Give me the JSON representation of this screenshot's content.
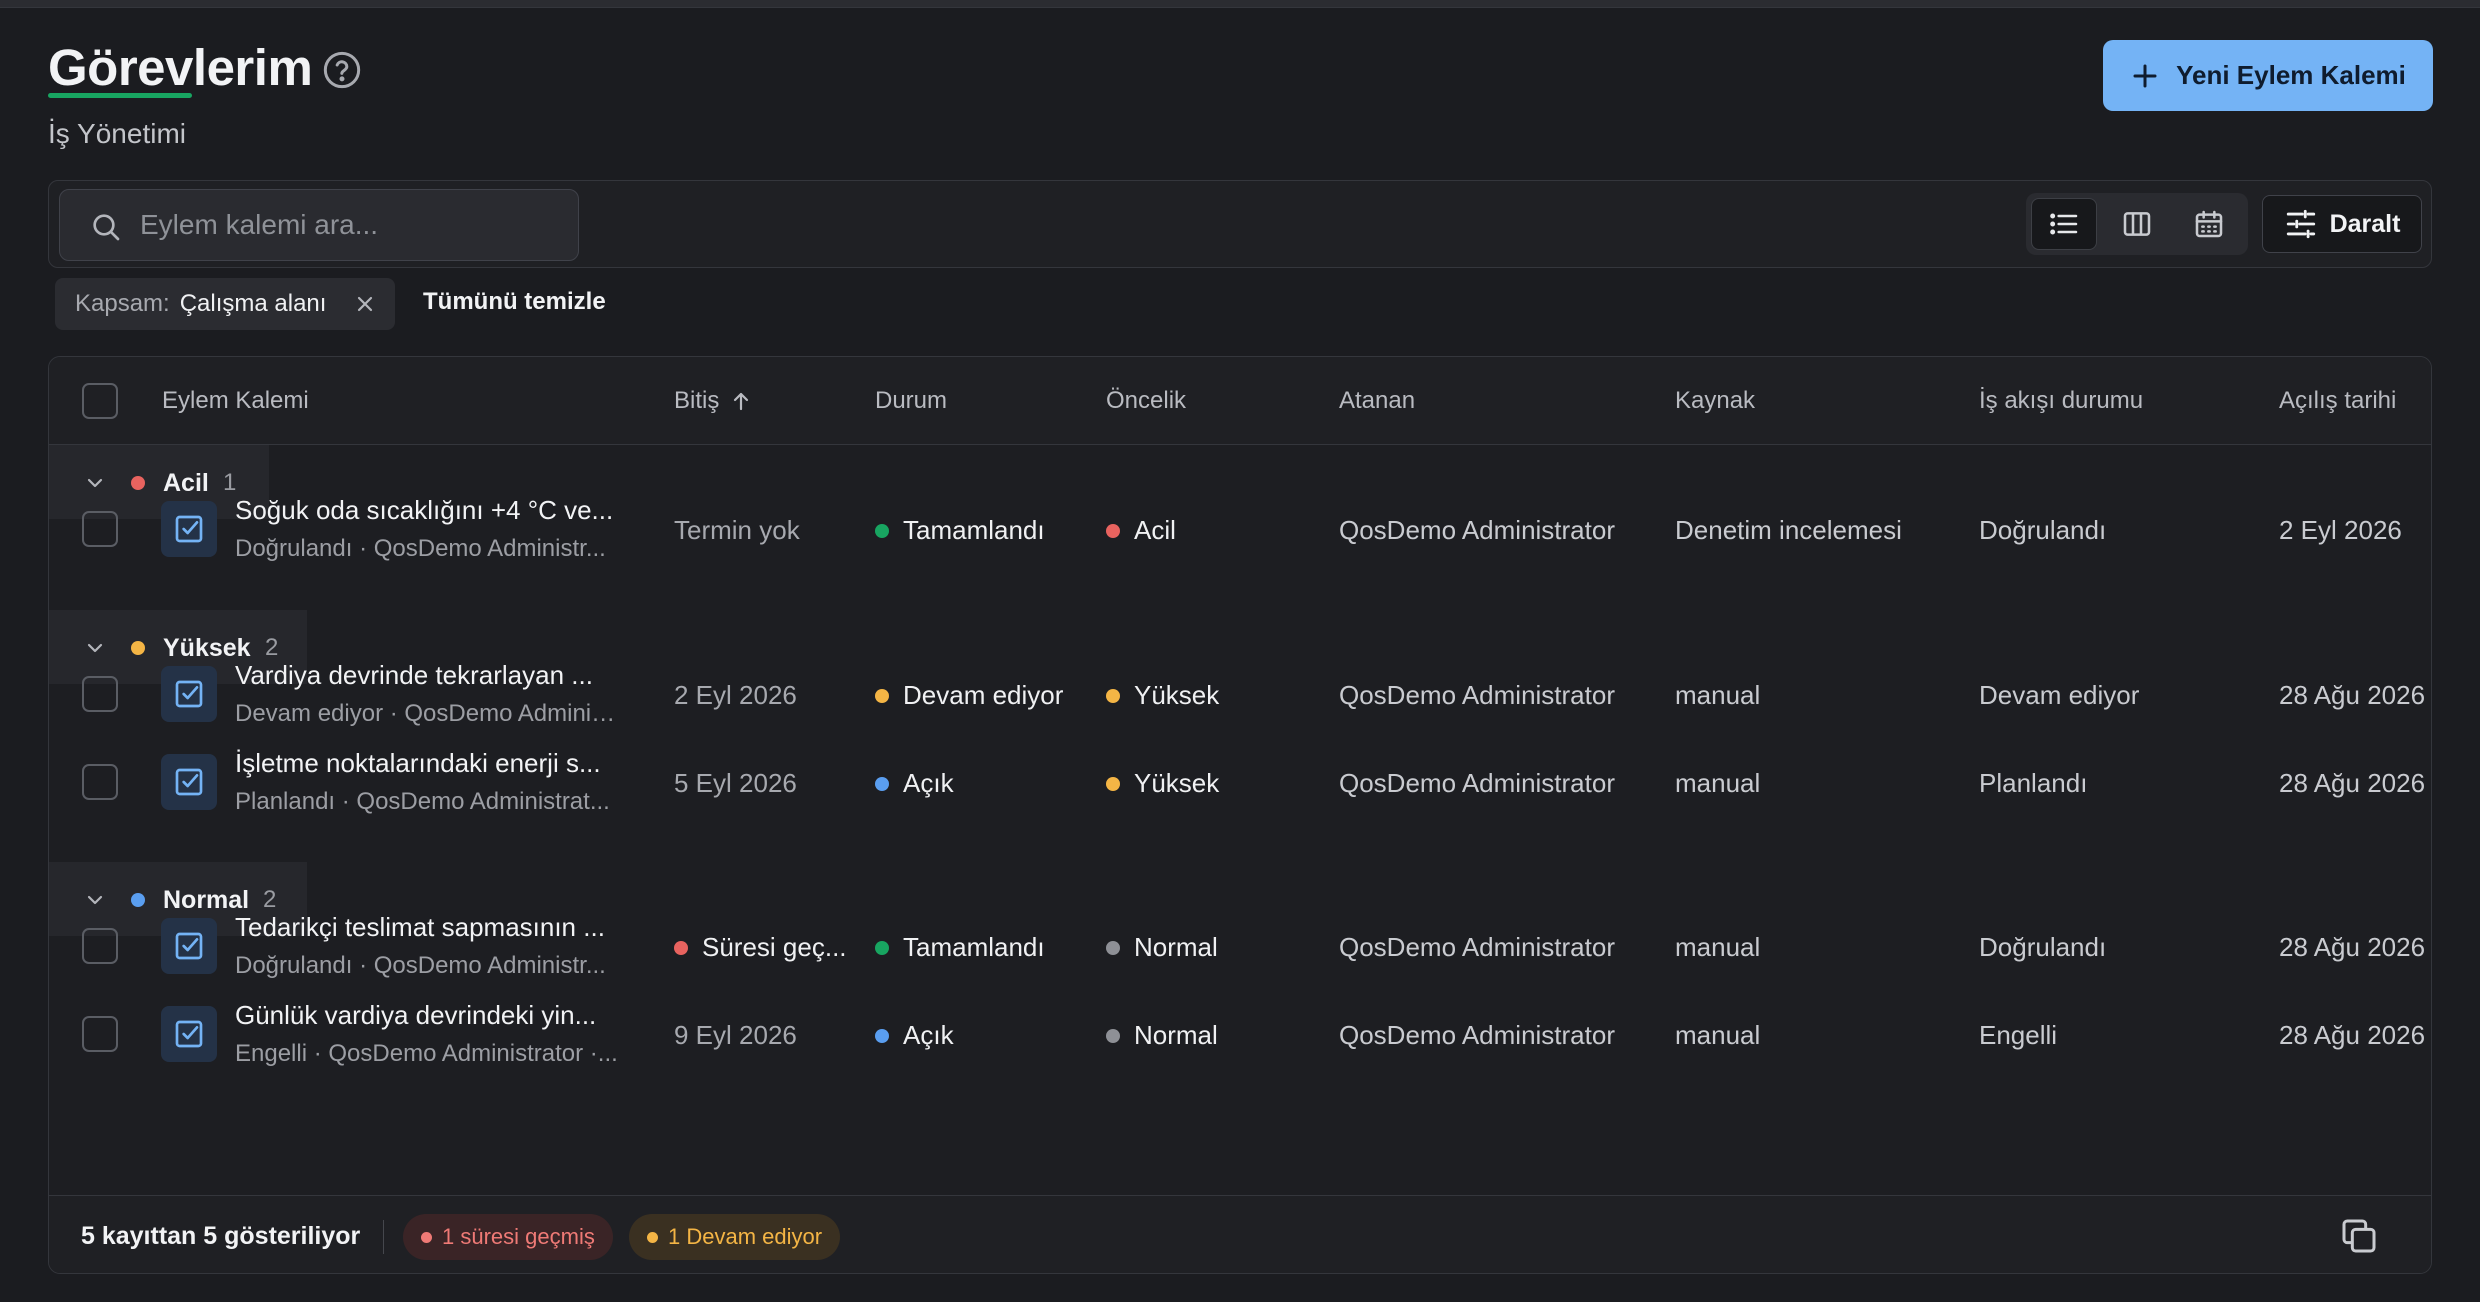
{
  "header": {
    "title": "Görevlerim",
    "subtitle": "İş Yönetimi",
    "new_button": "Yeni Eylem Kalemi"
  },
  "toolbar": {
    "search_placeholder": "Eylem kalemi ara...",
    "collapse_label": "Daralt",
    "views": [
      "list-view-icon",
      "columns-view-icon",
      "calendar-view-icon"
    ]
  },
  "filters": {
    "chip_key": "Kapsam:",
    "chip_value": "Çalışma alanı",
    "clear_all": "Tümünü temizle"
  },
  "table": {
    "columns": [
      "Eylem Kalemi",
      "Bitiş",
      "Durum",
      "Öncelik",
      "Atanan",
      "Kaynak",
      "İş akışı durumu",
      "Açılış tarihi"
    ],
    "groups": [
      {
        "label": "Acil",
        "count": "1",
        "color": "#e8635f",
        "rows": [
          {
            "title": "Soğuk oda sıcaklığını +4 °C ve...",
            "sub": "Doğrulandı · QosDemo Administr...",
            "due": "Termin yok",
            "due_overdue": false,
            "status": "Tamamlandı",
            "status_color": "#18a561",
            "priority": "Acil",
            "priority_color": "#e8635f",
            "assignee": "QosDemo Administrator",
            "source": "Denetim incelemesi",
            "workflow": "Doğrulandı",
            "opened": "2 Eyl 2026"
          }
        ]
      },
      {
        "label": "Yüksek",
        "count": "2",
        "color": "#f4b545",
        "rows": [
          {
            "title": "Vardiya devrinde tekrarlayan ...",
            "sub": "Devam ediyor · QosDemo Adminis...",
            "due": "2 Eyl 2026",
            "due_overdue": false,
            "status": "Devam ediyor",
            "status_color": "#f4b545",
            "priority": "Yüksek",
            "priority_color": "#f4b545",
            "assignee": "QosDemo Administrator",
            "source": "manual",
            "workflow": "Devam ediyor",
            "opened": "28 Ağu 2026"
          },
          {
            "title": "İşletme noktalarındaki enerji s...",
            "sub": "Planlandı · QosDemo Administrat...",
            "due": "5 Eyl 2026",
            "due_overdue": false,
            "status": "Açık",
            "status_color": "#5a9ef0",
            "priority": "Yüksek",
            "priority_color": "#f4b545",
            "assignee": "QosDemo Administrator",
            "source": "manual",
            "workflow": "Planlandı",
            "opened": "28 Ağu 2026"
          }
        ]
      },
      {
        "label": "Normal",
        "count": "2",
        "color": "#5a9ef0",
        "rows": [
          {
            "title": "Tedarikçi teslimat sapmasının ...",
            "sub": "Doğrulandı · QosDemo Administr...",
            "due": "Süresi geç...",
            "due_overdue": true,
            "status": "Tamamlandı",
            "status_color": "#18a561",
            "priority": "Normal",
            "priority_color": "#8e9096",
            "assignee": "QosDemo Administrator",
            "source": "manual",
            "workflow": "Doğrulandı",
            "opened": "28 Ağu 2026"
          },
          {
            "title": "Günlük vardiya devrindeki yin...",
            "sub": "Engelli · QosDemo Administrator ·...",
            "due": "9 Eyl 2026",
            "due_overdue": false,
            "status": "Açık",
            "status_color": "#5a9ef0",
            "priority": "Normal",
            "priority_color": "#8e9096",
            "assignee": "QosDemo Administrator",
            "source": "manual",
            "workflow": "Engelli",
            "opened": "28 Ağu 2026"
          }
        ]
      }
    ]
  },
  "footer": {
    "count_text": "5 kayıttan 5 gösteriliyor",
    "overdue_pill": "1 süresi geçmiş",
    "inprogress_pill": "1 Devam ediyor"
  },
  "colors": {
    "accent": "#74b3f5",
    "underline": "#18a561"
  }
}
